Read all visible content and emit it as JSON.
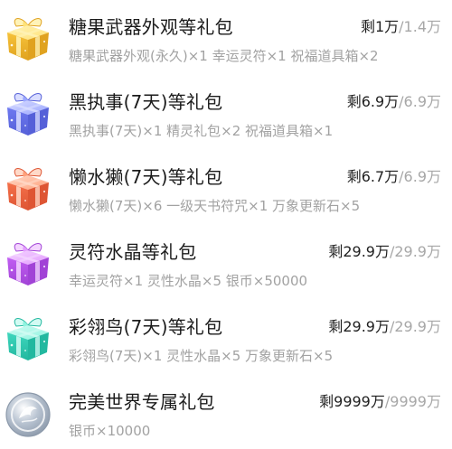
{
  "items": [
    {
      "icon": "gift-box-gold-icon",
      "title": "糖果武器外观等礼包",
      "remain_prefix": "剩",
      "remain": "1万",
      "total": "1.4万",
      "desc": "糖果武器外观(永久)×1 幸运灵符×1 祝福道具箱×2",
      "colors": {
        "top": "#ffe277",
        "mid": "#f6c23a",
        "side": "#e0a21f",
        "ribbon": "#fff3b8"
      }
    },
    {
      "icon": "gift-box-blue-icon",
      "title": "黑执事(7天)等礼包",
      "remain_prefix": "剩",
      "remain": "6.9万",
      "total": "6.9万",
      "desc": "黑执事(7天)×1 精灵礼包×2 祝福道具箱×1",
      "colors": {
        "top": "#9aa6ff",
        "mid": "#6e79f0",
        "side": "#5560d8",
        "ribbon": "#d9ddff"
      }
    },
    {
      "icon": "gift-box-orange-icon",
      "title": "懒水獭(7天)等礼包",
      "remain_prefix": "剩",
      "remain": "6.7万",
      "total": "6.9万",
      "desc": "懒水獭(7天)×6 一级天书符咒×1 万象更新石×5",
      "colors": {
        "top": "#ffa07a",
        "mid": "#f4704a",
        "side": "#de5533",
        "ribbon": "#ffd9c8"
      }
    },
    {
      "icon": "gift-box-purple-icon",
      "title": "灵符水晶等礼包",
      "remain_prefix": "剩",
      "remain": "29.9万",
      "total": "29.9万",
      "desc": "幸运灵符×1 灵性水晶×5 银币×50000",
      "colors": {
        "top": "#e39cff",
        "mid": "#c15ef2",
        "side": "#a143d6",
        "ribbon": "#f4d5ff"
      }
    },
    {
      "icon": "gift-box-teal-icon",
      "title": "彩翎鸟(7天)等礼包",
      "remain_prefix": "剩",
      "remain": "29.9万",
      "total": "29.9万",
      "desc": "彩翎鸟(7天)×1 灵性水晶×5 万象更新石×5",
      "colors": {
        "top": "#8ef3df",
        "mid": "#3fd6bd",
        "side": "#22b89f",
        "ribbon": "#d2fbf3"
      }
    },
    {
      "icon": "silver-coin-icon",
      "title": "完美世界专属礼包",
      "remain_prefix": "剩",
      "remain": "9999万",
      "total": "9999万",
      "desc": "银币×10000",
      "colors": {
        "top": "#e9eef5",
        "mid": "#b8c3d1",
        "side": "#8d9aab",
        "ribbon": "#ffffff"
      }
    }
  ]
}
